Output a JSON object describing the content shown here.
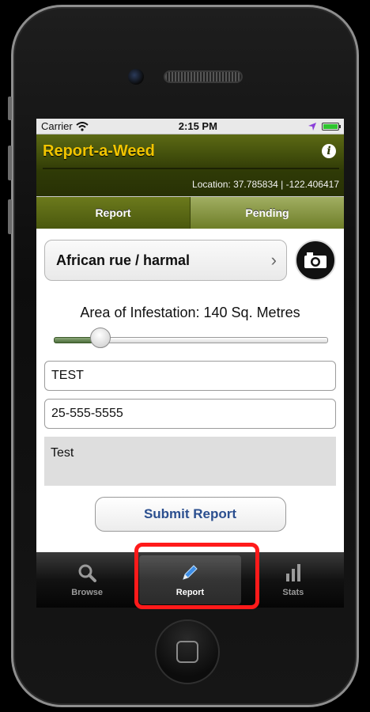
{
  "status_bar": {
    "carrier": "Carrier",
    "time": "2:15 PM"
  },
  "header": {
    "title": "Report-a-Weed",
    "location": "Location: 37.785834 | -122.406417"
  },
  "segments": [
    {
      "label": "Report",
      "selected": true
    },
    {
      "label": "Pending",
      "selected": false
    }
  ],
  "form": {
    "species": "African rue / harmal",
    "area_label": "Area of Infestation: 140 Sq. Metres",
    "slider_fraction": 0.15,
    "name_value": "TEST",
    "phone_value": "25-555-5555",
    "notes_value": "Test",
    "submit_label": "Submit Report"
  },
  "tabbar": {
    "browse": {
      "label": "Browse",
      "icon": "magnifier-icon"
    },
    "report": {
      "label": "Report",
      "icon": "pencil-icon",
      "selected": true
    },
    "stats": {
      "label": "Stats",
      "icon": "bar-chart-icon"
    }
  },
  "colors": {
    "title": "#f2c500",
    "header": "#2f3a06",
    "submit_text": "#2b4f8f",
    "highlight": "#ff1a1a"
  }
}
